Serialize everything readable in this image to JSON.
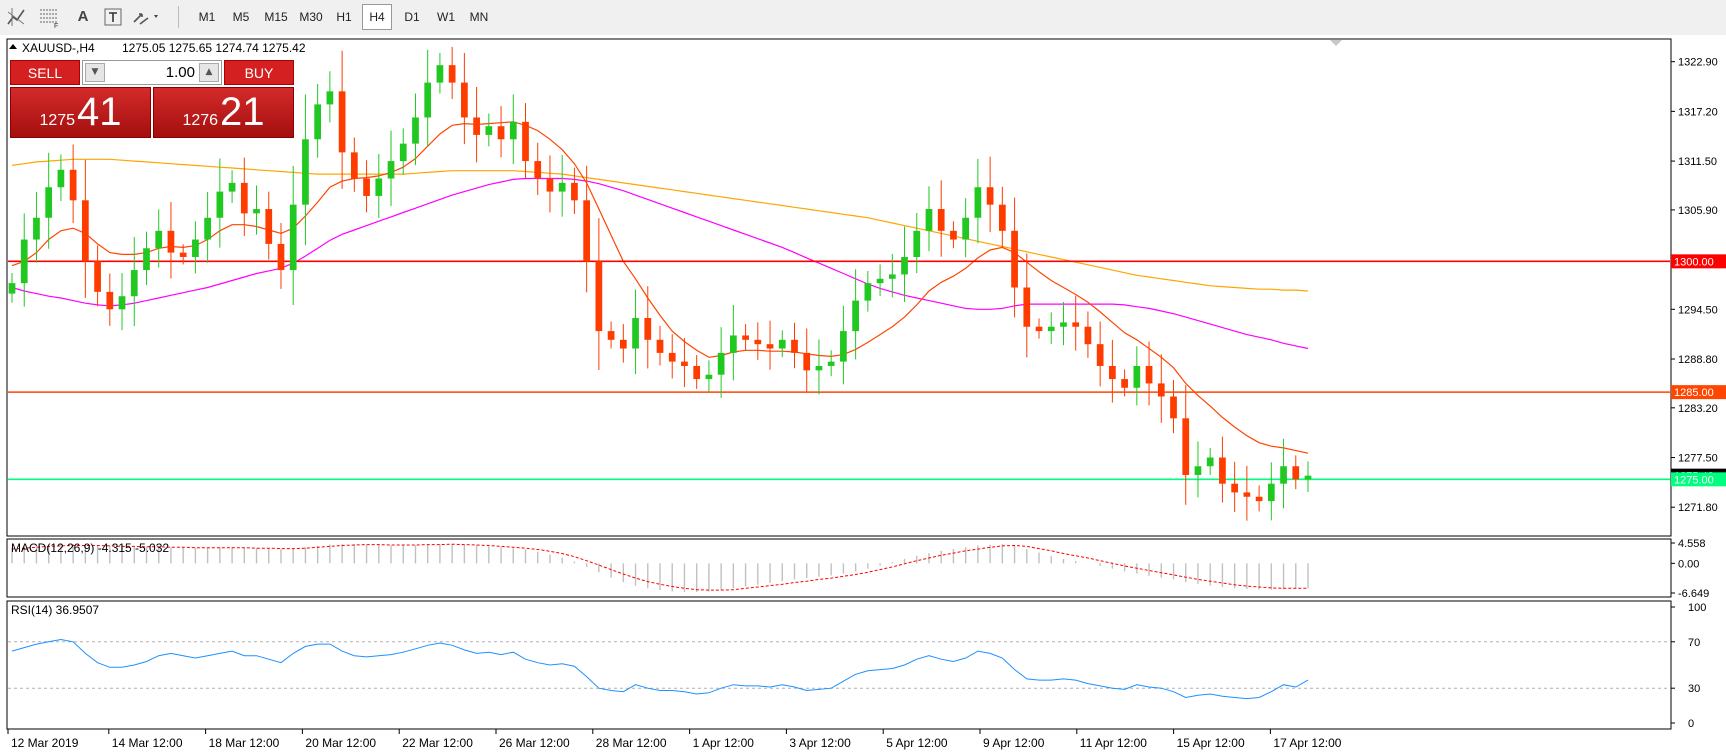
{
  "toolbar": {
    "icons": [
      "crosshair-indicator-icon",
      "fibonacci-icon",
      "text-tool-icon",
      "text-label-tool-icon",
      "arrows-tool-icon"
    ],
    "text_icon_label": "A",
    "timeframes": [
      "M1",
      "M5",
      "M15",
      "M30",
      "H1",
      "H4",
      "D1",
      "W1",
      "MN"
    ],
    "active_timeframe": "H4"
  },
  "chart_header": {
    "symbol": "XAUUSD-,H4",
    "ohlc": "1275.05 1275.65 1274.74 1275.42"
  },
  "trade_panel": {
    "sell_label": "SELL",
    "buy_label": "BUY",
    "volume": "1.00",
    "bid_prefix": "1275",
    "bid_big": "41",
    "ask_prefix": "1276",
    "ask_big": "21",
    "colors": {
      "panel": "#d42020"
    }
  },
  "colors": {
    "bull": "#22c822",
    "bear": "#ff3c00",
    "ma_fast": "#ff4500",
    "ma_mid": "#ff00ff",
    "ma_slow": "#ffa500",
    "level_1300": "#ff0000",
    "level_1285": "#ff4500",
    "level_1275": "#00ff7f",
    "rsi": "#1e90ff",
    "macd_signal": "#ff0000",
    "macd_hist": "#c0c0c0"
  },
  "chart_data": [
    {
      "type": "candlestick",
      "symbol": "XAUUSD-",
      "timeframe": "H4",
      "ylim": [
        1268.5,
        1325.5
      ],
      "y_ticks": [
        "1322.90",
        "1317.20",
        "1311.50",
        "1305.90",
        "1300.00",
        "1294.50",
        "1288.80",
        "1285.00",
        "1283.20",
        "1277.50",
        "1275.42",
        "1275.00",
        "1271.80"
      ],
      "x_ticks": [
        "12 Mar 2019",
        "14 Mar 12:00",
        "18 Mar 12:00",
        "20 Mar 12:00",
        "22 Mar 12:00",
        "26 Mar 12:00",
        "28 Mar 12:00",
        "1 Apr 12:00",
        "3 Apr 12:00",
        "5 Apr 12:00",
        "9 Apr 12:00",
        "11 Apr 12:00",
        "15 Apr 12:00",
        "17 Apr 12:00"
      ],
      "horizontal_levels": [
        {
          "price": 1300.0,
          "label": "1300.00"
        },
        {
          "price": 1285.0,
          "label": "1285.00"
        },
        {
          "price": 1275.0,
          "label": "1275.00"
        }
      ],
      "current_price": 1275.42,
      "close_path": [
        1297.5,
        1302.5,
        1305.0,
        1308.5,
        1310.5,
        1307.0,
        1300.0,
        1296.5,
        1294.5,
        1296.0,
        1299.0,
        1301.5,
        1303.5,
        1301.0,
        1300.5,
        1302.5,
        1305.0,
        1308.0,
        1309.0,
        1305.5,
        1306.0,
        1302.0,
        1299.0,
        1306.5,
        1314.0,
        1318.0,
        1319.5,
        1312.5,
        1309.5,
        1307.5,
        1309.5,
        1311.5,
        1313.5,
        1316.5,
        1320.5,
        1322.5,
        1320.5,
        1316.5,
        1314.5,
        1315.5,
        1314.0,
        1316.0,
        1311.5,
        1309.5,
        1308.0,
        1309.0,
        1307.0,
        1300.0,
        1292.0,
        1291.0,
        1290.0,
        1293.5,
        1291.0,
        1289.5,
        1288.5,
        1288.0,
        1286.5,
        1287.0,
        1289.5,
        1291.5,
        1291.0,
        1290.5,
        1290.0,
        1291.0,
        1289.5,
        1287.5,
        1288.0,
        1288.5,
        1292.0,
        1295.5,
        1297.5,
        1298.0,
        1298.5,
        1300.5,
        1303.5,
        1306.0,
        1303.5,
        1302.5,
        1305.0,
        1308.5,
        1306.5,
        1303.5,
        1297.0,
        1292.5,
        1292.0,
        1292.5,
        1293.0,
        1292.5,
        1290.5,
        1288.0,
        1286.5,
        1285.5,
        1288.0,
        1286.0,
        1284.5,
        1282.0,
        1275.5,
        1276.5,
        1277.5,
        1274.5,
        1273.5,
        1273.0,
        1272.5,
        1274.5,
        1276.5,
        1275.0,
        1275.42
      ],
      "ma_fast": [
        1299.5,
        1300.0,
        1301.0,
        1302.5,
        1303.5,
        1303.8,
        1303.2,
        1302.0,
        1301.0,
        1300.8,
        1300.8,
        1301.0,
        1301.5,
        1301.7,
        1301.6,
        1301.8,
        1302.5,
        1303.5,
        1304.2,
        1304.2,
        1304.0,
        1303.6,
        1303.2,
        1303.8,
        1305.2,
        1306.8,
        1308.5,
        1309.2,
        1309.5,
        1309.6,
        1309.8,
        1310.2,
        1310.8,
        1311.8,
        1313.2,
        1314.6,
        1315.6,
        1315.8,
        1315.7,
        1315.8,
        1315.9,
        1316.0,
        1315.6,
        1315.0,
        1314.0,
        1312.8,
        1311.2,
        1309.0,
        1306.0,
        1303.0,
        1300.0,
        1298.0,
        1295.8,
        1293.8,
        1292.0,
        1290.8,
        1289.8,
        1289.0,
        1289.2,
        1289.6,
        1289.8,
        1289.8,
        1289.7,
        1289.7,
        1289.6,
        1289.4,
        1289.2,
        1289.1,
        1289.3,
        1289.9,
        1290.7,
        1291.6,
        1292.5,
        1293.6,
        1295.0,
        1296.6,
        1297.6,
        1298.3,
        1299.2,
        1300.4,
        1301.3,
        1301.6,
        1301.0,
        1299.9,
        1298.8,
        1297.8,
        1297.0,
        1296.2,
        1295.3,
        1294.2,
        1293.0,
        1291.8,
        1291.0,
        1290.0,
        1289.0,
        1287.8,
        1286.0,
        1284.6,
        1283.4,
        1282.1,
        1281.0,
        1280.0,
        1279.2,
        1278.8,
        1278.6,
        1278.3,
        1278.0
      ],
      "ma_mid": [
        1297.0,
        1296.6,
        1296.3,
        1296.0,
        1295.8,
        1295.5,
        1295.2,
        1295.0,
        1294.9,
        1295.0,
        1295.2,
        1295.5,
        1295.8,
        1296.1,
        1296.4,
        1296.7,
        1297.0,
        1297.4,
        1297.8,
        1298.2,
        1298.6,
        1298.9,
        1299.2,
        1299.8,
        1300.6,
        1301.5,
        1302.4,
        1303.1,
        1303.6,
        1304.1,
        1304.6,
        1305.1,
        1305.6,
        1306.1,
        1306.6,
        1307.1,
        1307.6,
        1308.0,
        1308.4,
        1308.8,
        1309.1,
        1309.4,
        1309.5,
        1309.5,
        1309.5,
        1309.5,
        1309.4,
        1309.2,
        1308.9,
        1308.5,
        1308.1,
        1307.6,
        1307.1,
        1306.6,
        1306.1,
        1305.6,
        1305.1,
        1304.6,
        1304.1,
        1303.6,
        1303.1,
        1302.6,
        1302.1,
        1301.6,
        1301.0,
        1300.4,
        1299.8,
        1299.2,
        1298.6,
        1298.0,
        1297.4,
        1296.9,
        1296.5,
        1296.1,
        1295.8,
        1295.5,
        1295.2,
        1294.9,
        1294.6,
        1294.5,
        1294.5,
        1294.6,
        1294.9,
        1295.1,
        1295.1,
        1295.1,
        1295.1,
        1295.1,
        1295.1,
        1295.1,
        1295.1,
        1295.0,
        1294.8,
        1294.6,
        1294.3,
        1294.0,
        1293.6,
        1293.2,
        1292.8,
        1292.4,
        1292.0,
        1291.6,
        1291.3,
        1291.0,
        1290.6,
        1290.3,
        1290.0
      ],
      "ma_slow": [
        1311.0,
        1311.2,
        1311.4,
        1311.5,
        1311.6,
        1311.7,
        1311.7,
        1311.7,
        1311.7,
        1311.6,
        1311.5,
        1311.4,
        1311.3,
        1311.2,
        1311.1,
        1311.0,
        1310.9,
        1310.8,
        1310.7,
        1310.6,
        1310.5,
        1310.4,
        1310.3,
        1310.2,
        1310.1,
        1310.0,
        1310.0,
        1310.0,
        1310.0,
        1310.0,
        1310.0,
        1310.0,
        1310.0,
        1310.1,
        1310.2,
        1310.3,
        1310.4,
        1310.4,
        1310.4,
        1310.4,
        1310.4,
        1310.4,
        1310.3,
        1310.2,
        1310.1,
        1310.0,
        1309.8,
        1309.6,
        1309.4,
        1309.2,
        1309.0,
        1308.8,
        1308.6,
        1308.4,
        1308.2,
        1308.0,
        1307.8,
        1307.6,
        1307.4,
        1307.2,
        1307.0,
        1306.8,
        1306.6,
        1306.4,
        1306.2,
        1306.0,
        1305.8,
        1305.6,
        1305.4,
        1305.2,
        1305.0,
        1304.7,
        1304.4,
        1304.1,
        1303.8,
        1303.5,
        1303.2,
        1302.9,
        1302.6,
        1302.3,
        1302.0,
        1301.7,
        1301.4,
        1301.1,
        1300.8,
        1300.5,
        1300.2,
        1299.9,
        1299.6,
        1299.3,
        1299.0,
        1298.7,
        1298.4,
        1298.2,
        1298.0,
        1297.8,
        1297.6,
        1297.4,
        1297.2,
        1297.1,
        1297.0,
        1296.9,
        1296.8,
        1296.8,
        1296.7,
        1296.7,
        1296.6
      ]
    },
    {
      "type": "macd",
      "label": "MACD(12,26,9) -4.315 -5.032",
      "y_ticks": [
        "4.558",
        "0.00",
        "-6.649"
      ],
      "ylim": [
        -6.649,
        4.558
      ],
      "histogram": [
        3.5,
        3.8,
        4.0,
        4.2,
        4.3,
        4.3,
        4.2,
        4.0,
        3.8,
        3.7,
        3.7,
        3.7,
        3.7,
        3.6,
        3.5,
        3.5,
        3.5,
        3.6,
        3.6,
        3.5,
        3.4,
        3.3,
        3.2,
        3.3,
        3.6,
        3.9,
        4.2,
        4.3,
        4.3,
        4.2,
        4.1,
        4.0,
        4.0,
        4.1,
        4.2,
        4.3,
        4.3,
        4.2,
        4.0,
        3.8,
        3.6,
        3.4,
        3.1,
        2.6,
        2.0,
        1.3,
        0.4,
        -0.8,
        -2.0,
        -3.2,
        -4.2,
        -5.0,
        -5.6,
        -6.0,
        -6.3,
        -6.4,
        -6.4,
        -6.3,
        -6.0,
        -5.6,
        -5.2,
        -4.8,
        -4.4,
        -4.0,
        -3.6,
        -3.3,
        -3.0,
        -2.7,
        -2.3,
        -1.8,
        -1.2,
        -0.5,
        0.3,
        1.0,
        1.7,
        2.3,
        2.8,
        3.2,
        3.6,
        4.0,
        4.2,
        4.3,
        4.0,
        3.2,
        2.4,
        1.6,
        1.0,
        0.5,
        0.0,
        -0.6,
        -1.2,
        -1.8,
        -2.3,
        -2.8,
        -3.2,
        -3.6,
        -4.2,
        -4.6,
        -5.0,
        -5.3,
        -5.6,
        -5.8,
        -5.9,
        -5.9,
        -5.8,
        -5.7,
        -5.6
      ],
      "signal": [
        3.2,
        3.4,
        3.6,
        3.8,
        3.9,
        4.0,
        4.0,
        4.0,
        3.9,
        3.8,
        3.8,
        3.7,
        3.7,
        3.6,
        3.6,
        3.5,
        3.5,
        3.5,
        3.5,
        3.5,
        3.4,
        3.4,
        3.3,
        3.3,
        3.4,
        3.6,
        3.8,
        4.0,
        4.1,
        4.2,
        4.2,
        4.1,
        4.1,
        4.1,
        4.2,
        4.2,
        4.3,
        4.2,
        4.1,
        4.0,
        3.8,
        3.6,
        3.4,
        3.1,
        2.7,
        2.2,
        1.5,
        0.6,
        -0.4,
        -1.4,
        -2.4,
        -3.3,
        -4.1,
        -4.7,
        -5.2,
        -5.6,
        -5.9,
        -6.0,
        -6.0,
        -5.9,
        -5.6,
        -5.3,
        -5.0,
        -4.7,
        -4.3,
        -4.0,
        -3.6,
        -3.3,
        -2.9,
        -2.5,
        -2.0,
        -1.4,
        -0.8,
        -0.1,
        0.6,
        1.2,
        1.8,
        2.3,
        2.8,
        3.2,
        3.6,
        3.9,
        4.0,
        3.8,
        3.3,
        2.8,
        2.2,
        1.7,
        1.2,
        0.6,
        0.0,
        -0.6,
        -1.1,
        -1.6,
        -2.1,
        -2.6,
        -3.1,
        -3.6,
        -4.0,
        -4.4,
        -4.8,
        -5.1,
        -5.3,
        -5.5,
        -5.6,
        -5.6,
        -5.6
      ]
    },
    {
      "type": "line",
      "label": "RSI(14) 36.9507",
      "y_ticks": [
        "100",
        "70",
        "30",
        "0"
      ],
      "ylim": [
        0,
        100
      ],
      "levels": [
        70,
        30
      ],
      "values": [
        62,
        65,
        68,
        70,
        72,
        70,
        60,
        52,
        48,
        48,
        50,
        53,
        58,
        60,
        58,
        56,
        58,
        60,
        62,
        58,
        58,
        55,
        52,
        60,
        66,
        68,
        68,
        62,
        58,
        57,
        58,
        59,
        61,
        64,
        67,
        69,
        67,
        63,
        60,
        61,
        59,
        61,
        55,
        52,
        50,
        51,
        49,
        40,
        30,
        28,
        27,
        33,
        30,
        28,
        28,
        27,
        25,
        26,
        30,
        33,
        32,
        32,
        31,
        33,
        31,
        28,
        29,
        30,
        36,
        42,
        45,
        46,
        47,
        50,
        55,
        58,
        55,
        53,
        56,
        62,
        60,
        56,
        46,
        38,
        37,
        37,
        38,
        37,
        34,
        32,
        30,
        29,
        33,
        31,
        30,
        27,
        22,
        24,
        25,
        23,
        22,
        21,
        22,
        27,
        33,
        31,
        36.9507
      ]
    }
  ]
}
